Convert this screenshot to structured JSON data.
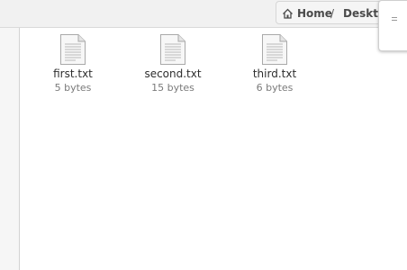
{
  "pathbar": {
    "home_label": "Home",
    "separator": "/",
    "current_label": "Deskto"
  },
  "files": [
    {
      "name": "first.txt",
      "size": "5 bytes",
      "icon": "text-file-icon"
    },
    {
      "name": "second.txt",
      "size": "15 bytes",
      "icon": "text-file-icon"
    },
    {
      "name": "third.txt",
      "size": "6 bytes",
      "icon": "text-file-icon"
    }
  ]
}
